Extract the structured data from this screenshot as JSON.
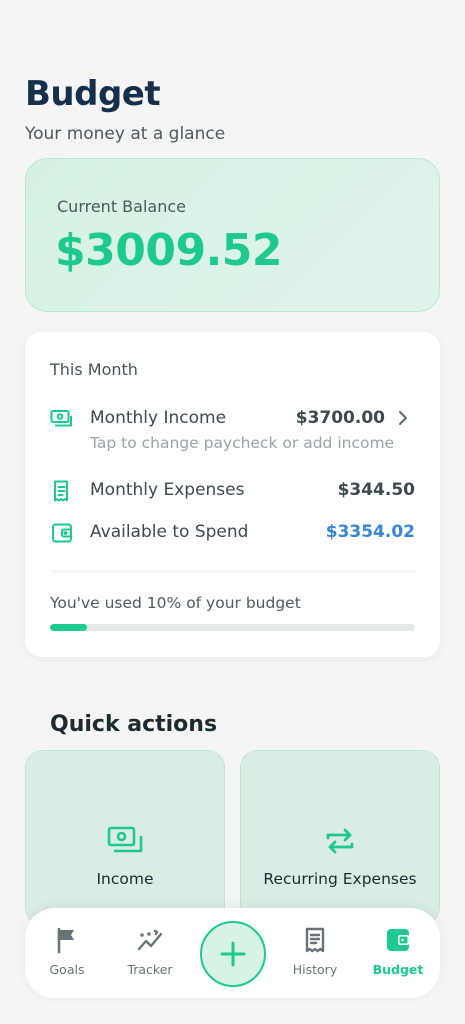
{
  "header": {
    "title": "Budget",
    "subtitle": "Your money at a glance"
  },
  "balance": {
    "label": "Current Balance",
    "value": "$3009.52"
  },
  "this_month": {
    "heading": "This Month",
    "income": {
      "label": "Monthly Income",
      "value": "$3700.00",
      "hint": "Tap to change paycheck or add income",
      "icon": "cash-icon"
    },
    "expenses": {
      "label": "Monthly Expenses",
      "value": "$344.50",
      "icon": "receipt-icon"
    },
    "available": {
      "label": "Available to Spend",
      "value": "$3354.02",
      "icon": "wallet-icon"
    },
    "usage_text": "You've used 10% of your budget",
    "usage_fraction": 0.1
  },
  "quick_actions": {
    "title": "Quick actions",
    "items": [
      {
        "label": "Income",
        "icon": "cash-icon"
      },
      {
        "label": "Recurring Expenses",
        "icon": "repeat-icon"
      }
    ]
  },
  "nav": {
    "items": [
      {
        "label": "Goals",
        "icon": "flag-icon"
      },
      {
        "label": "Tracker",
        "icon": "trend-icon"
      },
      {
        "label": "History",
        "icon": "receipt-icon"
      },
      {
        "label": "Budget",
        "icon": "wallet-icon",
        "active": true
      }
    ],
    "add_icon": "plus-icon"
  },
  "colors": {
    "accent": "#1dc98f",
    "title": "#16304b",
    "available_value": "#3a86d4",
    "balance_card_bg": "#d5f1e4"
  }
}
